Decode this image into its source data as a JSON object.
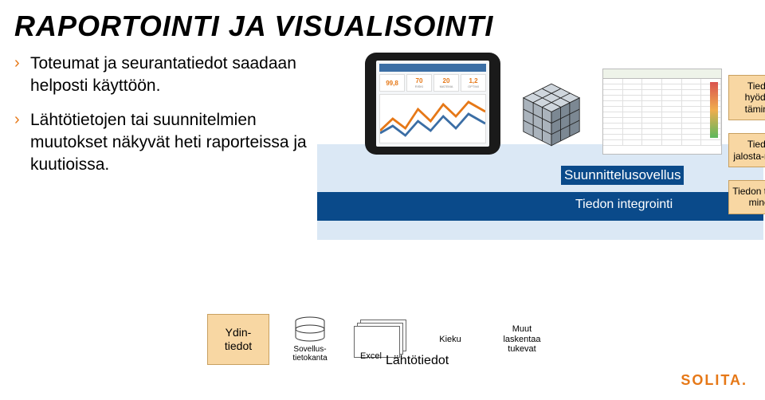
{
  "title": "RAPORTOINTI JA VISUALISOINTI",
  "bullets": [
    "Toteumat ja seurantatiedot saadaan helposti käyttöön.",
    "Lähtötietojen tai suunnitelmien muutokset näkyvät heti raporteissa ja kuutioissa."
  ],
  "tablet": {
    "tiles": [
      {
        "num": "99,8",
        "lbl": ""
      },
      {
        "num": "70",
        "lbl": "RISKI"
      },
      {
        "num": "20",
        "lbl": "MATEMA"
      },
      {
        "num": "1,2",
        "lbl": "OPTIMI"
      }
    ]
  },
  "labels": {
    "suunnittelu": "Suunnittelusovellus",
    "integrointi": "Tiedon integrointi",
    "ydin": "Ydin-\ntiedot",
    "db": "Sovellus-\ntietokanta",
    "excel": "Excel",
    "kieku": "Kieku",
    "muut": "Muut\nlaskentaa\ntukevat",
    "lahto": "Lähtötiedot"
  },
  "side": [
    "Tiedon hyödyn-täminen",
    "Tiedon jalosta-minen",
    "Tiedon tuotta-minen"
  ],
  "logo": "SOLITA"
}
